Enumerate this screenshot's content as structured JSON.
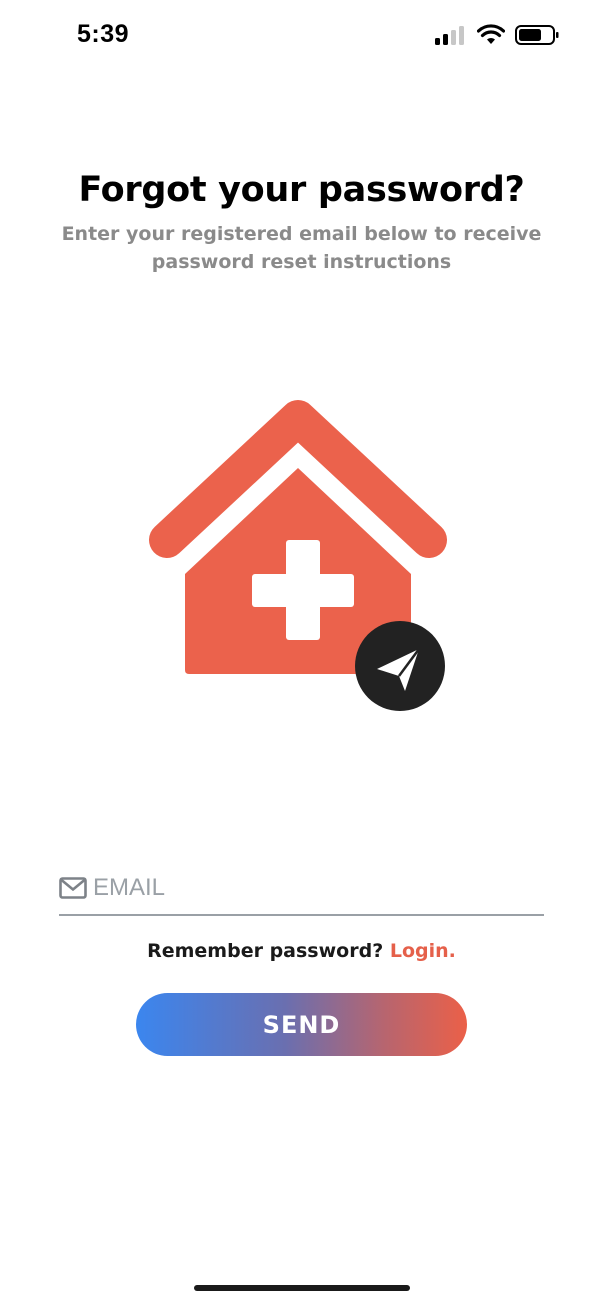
{
  "status_bar": {
    "time": "5:39",
    "icons": [
      "signal-icon",
      "wifi-icon",
      "battery-icon"
    ]
  },
  "header": {
    "title": "Forgot your password?",
    "subtitle": "Enter your registered email below to receive password reset instructions"
  },
  "illustration": {
    "house_icon": "medical-house-icon",
    "badge_icon": "paper-plane-icon",
    "house_color": "#EB624C",
    "badge_color": "#222222"
  },
  "form": {
    "email_placeholder": "EMAIL",
    "email_value": "",
    "field_icon": "mail-icon"
  },
  "remember": {
    "text": "Remember password?",
    "link": "Login."
  },
  "send_button": {
    "label": "SEND",
    "gradient_start": "#3B86EF",
    "gradient_end": "#EB6048"
  },
  "colors": {
    "accent": "#E5604A",
    "muted_text": "#8A8A8A"
  }
}
